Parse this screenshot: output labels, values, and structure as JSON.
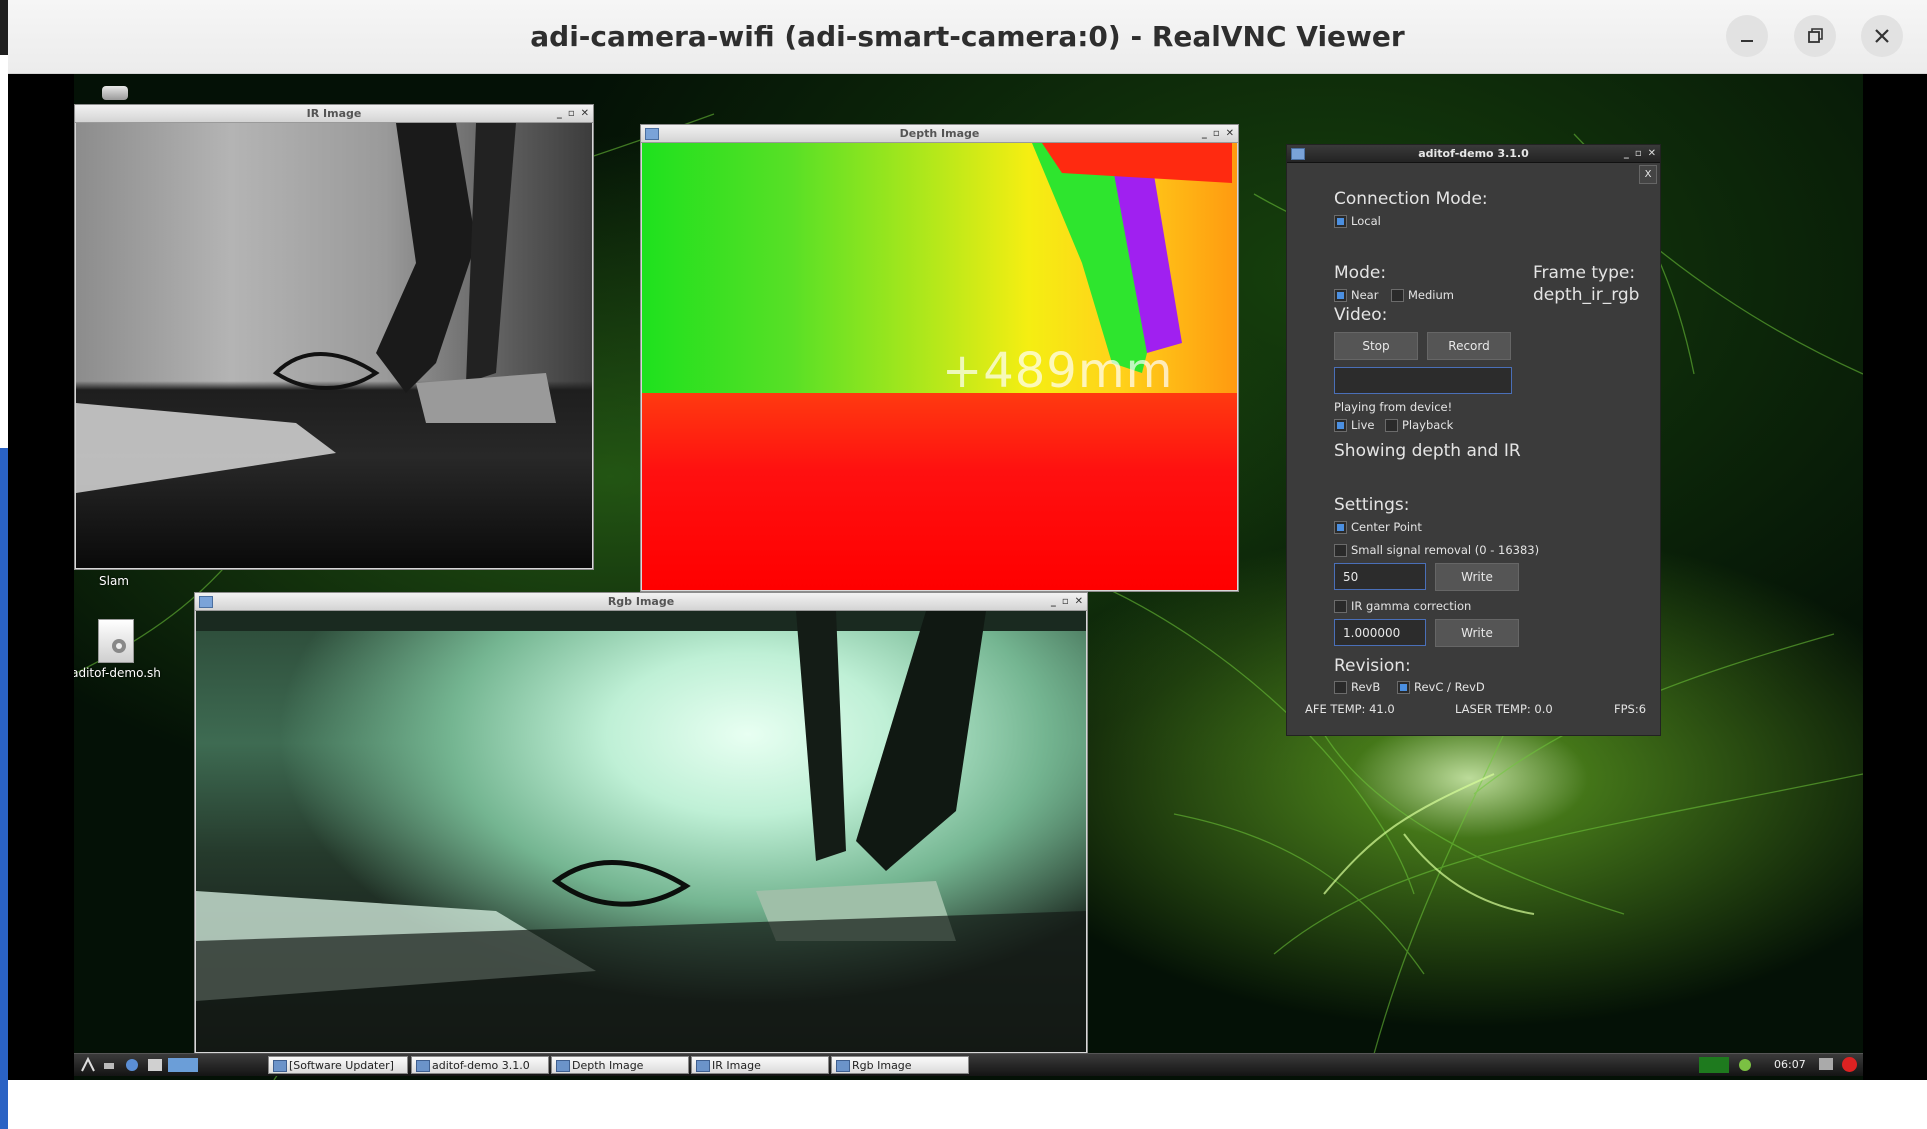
{
  "vnc": {
    "title": "adi-camera-wifi (adi-smart-camera:0) - RealVNC Viewer",
    "controls": {
      "minimize": "minimize-icon",
      "restore": "restore-icon",
      "close": "close-icon"
    }
  },
  "desktop": {
    "icons": [
      {
        "label": "Slam",
        "icon": "drive-icon"
      },
      {
        "label": "aditof-demo.sh",
        "icon": "script-gear-icon"
      }
    ]
  },
  "windows": {
    "ir": {
      "title": "IR Image"
    },
    "depth": {
      "title": "Depth Image",
      "overlay": "+489mm"
    },
    "rgb": {
      "title": "Rgb Image"
    }
  },
  "panel": {
    "title": "aditof-demo 3.1.0",
    "close_x": "X",
    "connection_mode_label": "Connection Mode:",
    "local_label": "Local",
    "local_checked": true,
    "mode_label": "Mode:",
    "near_label": "Near",
    "near_checked": true,
    "medium_label": "Medium",
    "medium_checked": false,
    "frame_type_label": "Frame type:",
    "frame_type_value": "depth_ir_rgb",
    "video_label": "Video:",
    "stop_label": "Stop",
    "record_label": "Record",
    "record_path_value": "",
    "playing_from_label": "Playing from device!",
    "live_label": "Live",
    "live_checked": true,
    "playback_label": "Playback",
    "playback_checked": false,
    "showing_label": "Showing depth and IR",
    "settings_label": "Settings:",
    "center_point_label": "Center Point",
    "center_point_checked": true,
    "small_signal_label": "Small signal removal (0 - 16383)",
    "small_signal_checked": false,
    "small_signal_value": "50",
    "write_label": "Write",
    "ir_gamma_label": "IR gamma correction",
    "ir_gamma_checked": false,
    "ir_gamma_value": "1.000000",
    "revision_label": "Revision:",
    "revb_label": "RevB",
    "revb_checked": false,
    "revcd_label": "RevC / RevD",
    "revcd_checked": true,
    "afe_temp": "AFE TEMP: 41.0",
    "laser_temp": "LASER TEMP: 0.0",
    "fps": "FPS:6"
  },
  "taskbar": {
    "tasks": [
      {
        "label": "[Software Updater]"
      },
      {
        "label": "aditof-demo 3.1.0"
      },
      {
        "label": "Depth Image"
      },
      {
        "label": "IR Image"
      },
      {
        "label": "Rgb Image"
      }
    ],
    "clock": "06:07"
  }
}
